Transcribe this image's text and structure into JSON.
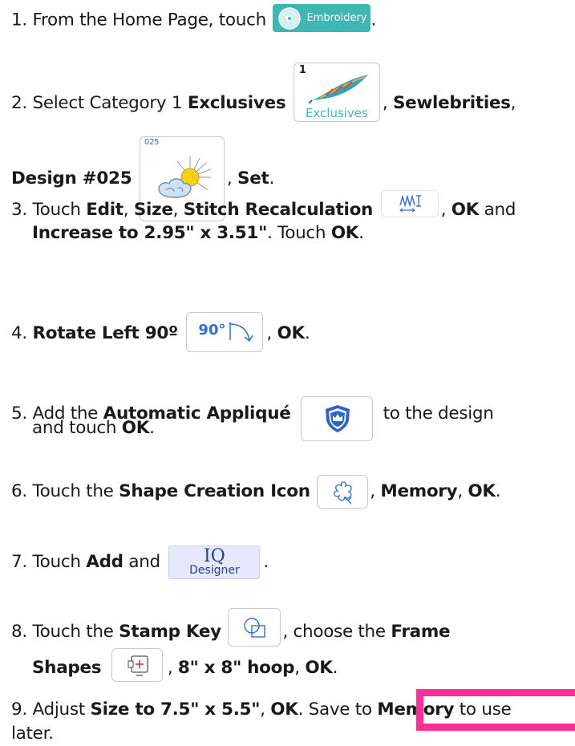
{
  "steps": [
    {
      "num": "1.",
      "t1": "From the Home Page, touch",
      "embroidery_label": "Embroidery",
      "t2": "."
    },
    {
      "num": "2.",
      "t1": "Select Category 1",
      "b1": "Exclusives",
      "exclusives_num": "1",
      "exclusives_label": "Exclusives",
      "t2": ",",
      "b2": "Sewlebrities",
      "t3": ",",
      "b3": "Design #025",
      "design_num": "025",
      "t4": ",",
      "b4": "Set",
      "t5": "."
    },
    {
      "num": "3.",
      "t1": "Touch",
      "b1": "Edit",
      "t2": ",",
      "b2": "Size",
      "t3": ",",
      "b3": "Stitch Recalculation",
      "t4": ",",
      "b4": "OK",
      "t5": "and",
      "b5": "Increase to 2.95\" x 3.51\"",
      "t6": ". Touch",
      "b6": "OK",
      "t7": "."
    },
    {
      "num": "4.",
      "b1": "Rotate Left 90º",
      "rotate_label": "90°",
      "t1": ",",
      "b2": "OK",
      "t2": "."
    },
    {
      "num": "5.",
      "t1": "Add the",
      "b1": "Automatic Appliqué",
      "t2": "to the design",
      "t3": "and touch",
      "b2": "OK",
      "t4": "."
    },
    {
      "num": "6.",
      "t1": "Touch the",
      "b1": "Shape Creation Icon",
      "t2": ",",
      "b2": "Memory",
      "t3": ",",
      "b3": "OK",
      "t4": "."
    },
    {
      "num": "7.",
      "t1": "Touch",
      "b1": "Add",
      "t2": "and",
      "iq_top": "IQ",
      "iq_bottom": "Designer",
      "t3": "."
    },
    {
      "num": "8.",
      "t1": "Touch the",
      "b1": "Stamp Key",
      "t2": ", choose the",
      "b2": "Frame",
      "b3": "Shapes",
      "t3": ",",
      "b4": "8\" x 8\" hoop",
      "t4": ",",
      "b5": "OK",
      "t5": "."
    },
    {
      "num": "9.",
      "t1": "Adjust",
      "b1": "Size to 7.5\" x 5.5\"",
      "t2": ",",
      "b2": "OK",
      "t3": ". Save to",
      "b3": "Memory",
      "t4": "to use",
      "t5": "later."
    }
  ],
  "colors": {
    "text": "#1a1a1a",
    "teal": "#3fb6b2",
    "highlight": "#ff2d95",
    "blue": "#2b6fd6",
    "iq_bg": "#e6e8fb",
    "iq_text": "#25408f"
  }
}
